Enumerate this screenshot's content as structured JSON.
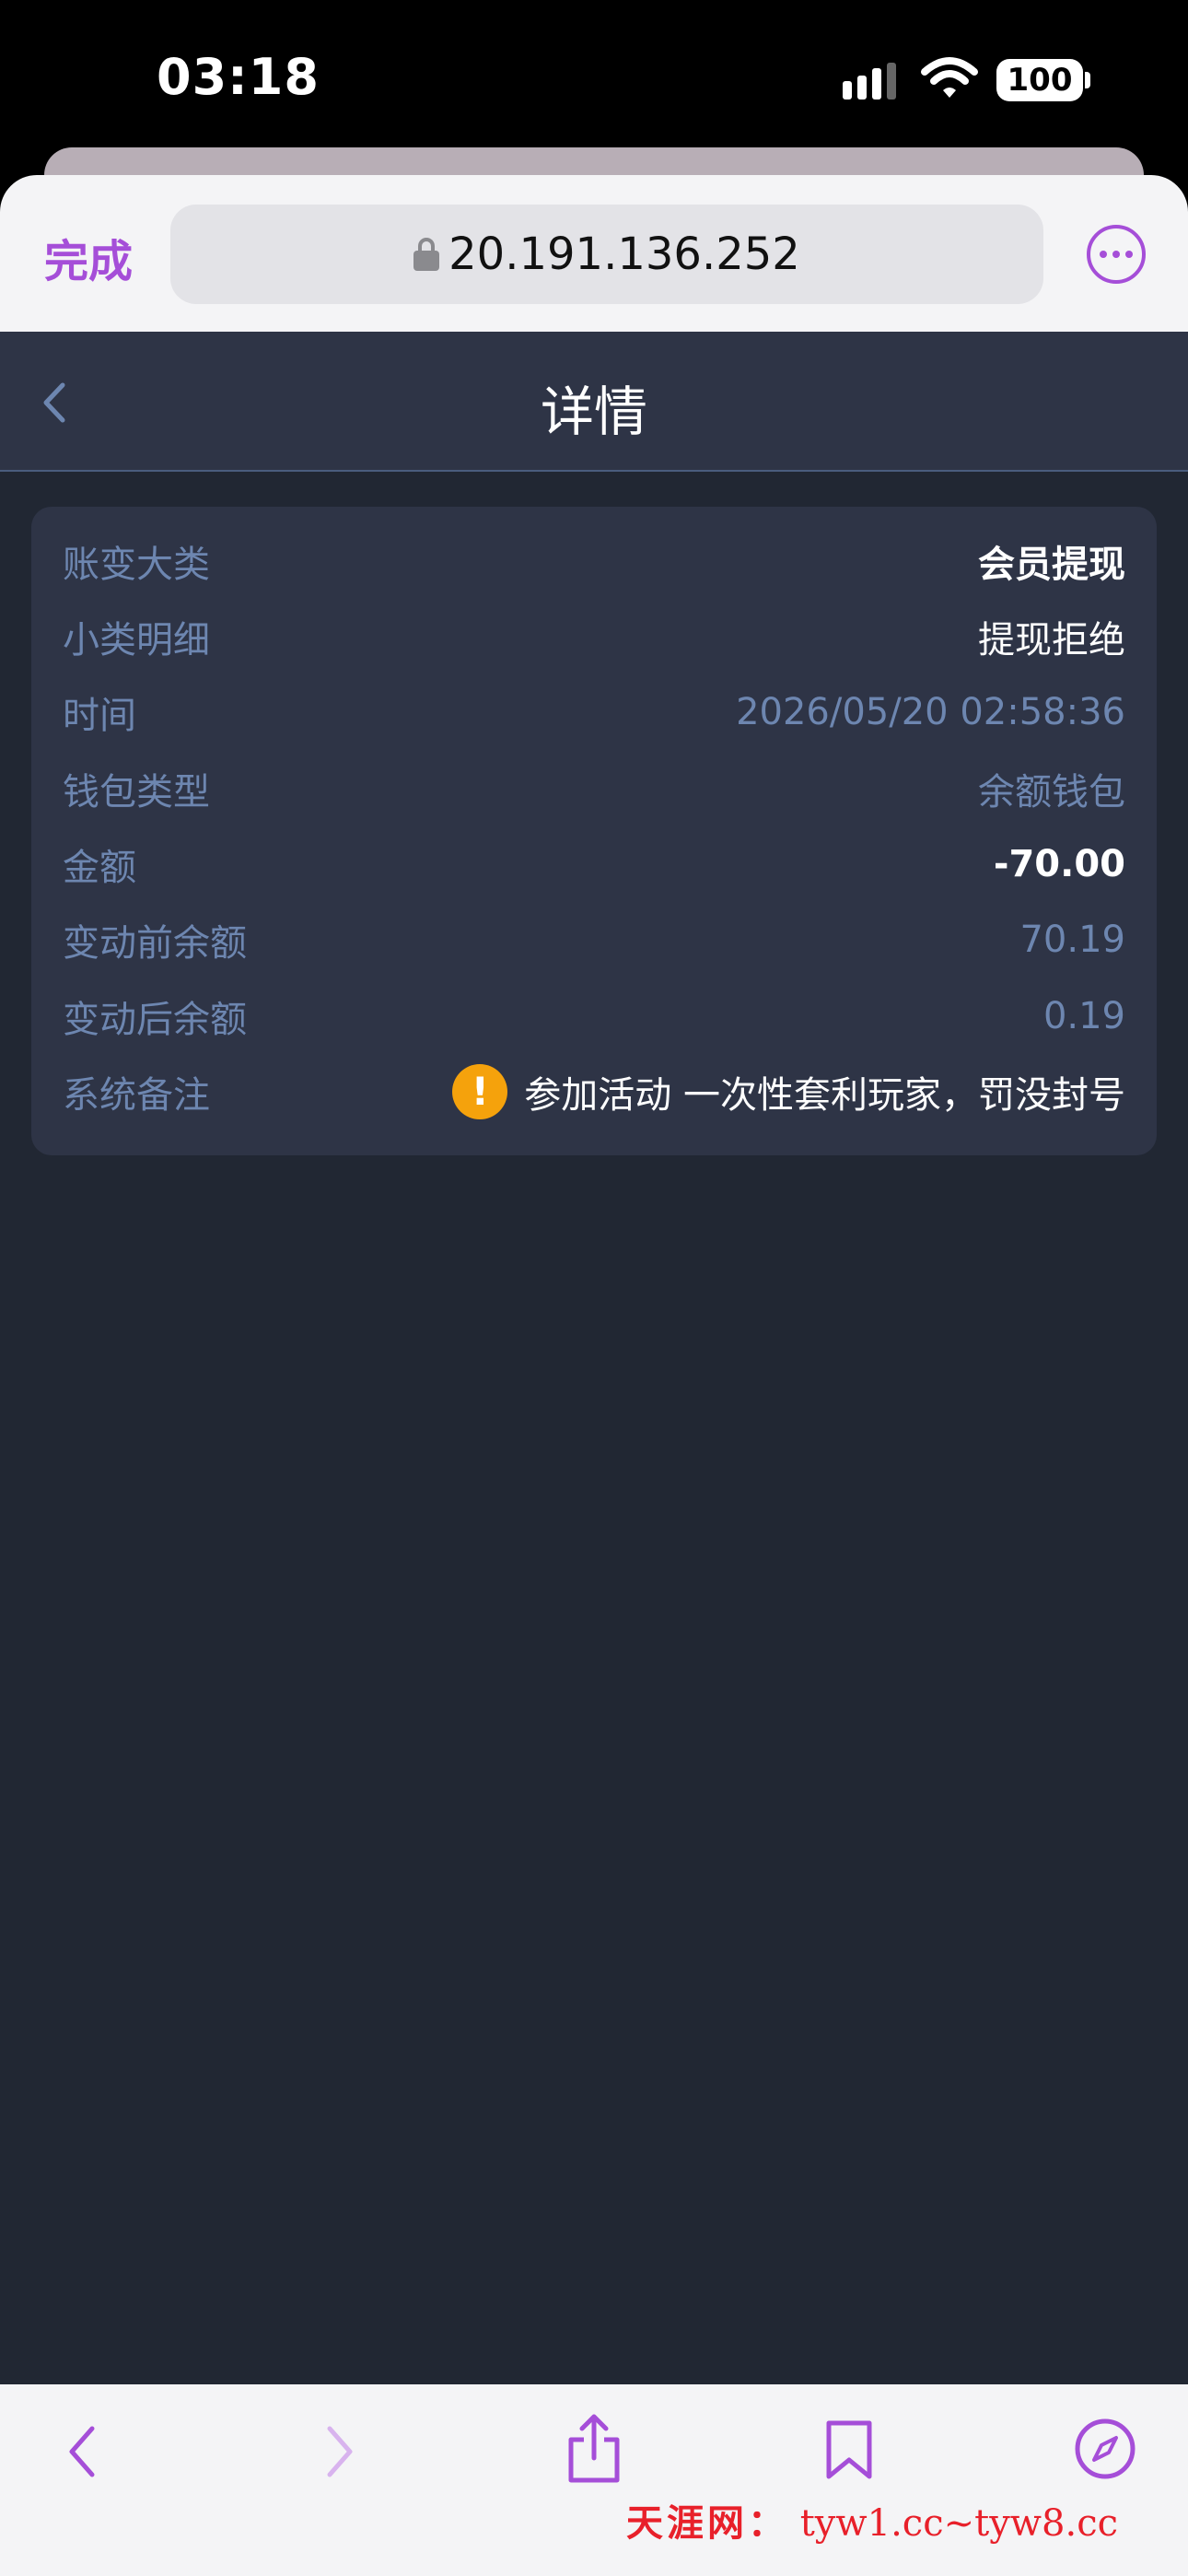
{
  "status_bar": {
    "time": "03:18",
    "battery": "100",
    "icons": [
      "signal-icon",
      "wifi-icon",
      "battery-icon"
    ]
  },
  "browser": {
    "done_label": "完成",
    "url": "20.191.136.252",
    "accent_color": "#a54ed8"
  },
  "header": {
    "title": "详情"
  },
  "details": {
    "rows": [
      {
        "label": "账变大类",
        "value": "会员提现"
      },
      {
        "label": "小类明细",
        "value": "提现拒绝"
      },
      {
        "label": "时间",
        "value": "2026/05/20 02:58:36"
      },
      {
        "label": "钱包类型",
        "value": "余额钱包"
      },
      {
        "label": "金额",
        "value": "-70.00"
      },
      {
        "label": "变动前余额",
        "value": "70.19"
      },
      {
        "label": "变动后余额",
        "value": "0.19"
      },
      {
        "label": "系统备注",
        "value": "参加活动 一次性套利玩家，罚没封号"
      }
    ],
    "warning_color": "#f5a20c"
  },
  "toolbar": {
    "icons": [
      "back-icon",
      "forward-icon",
      "share-icon",
      "bookmark-icon",
      "compass-icon"
    ]
  },
  "watermark": {
    "name": "天涯网：",
    "domains": "tyw1.cc~tyw8.cc"
  }
}
